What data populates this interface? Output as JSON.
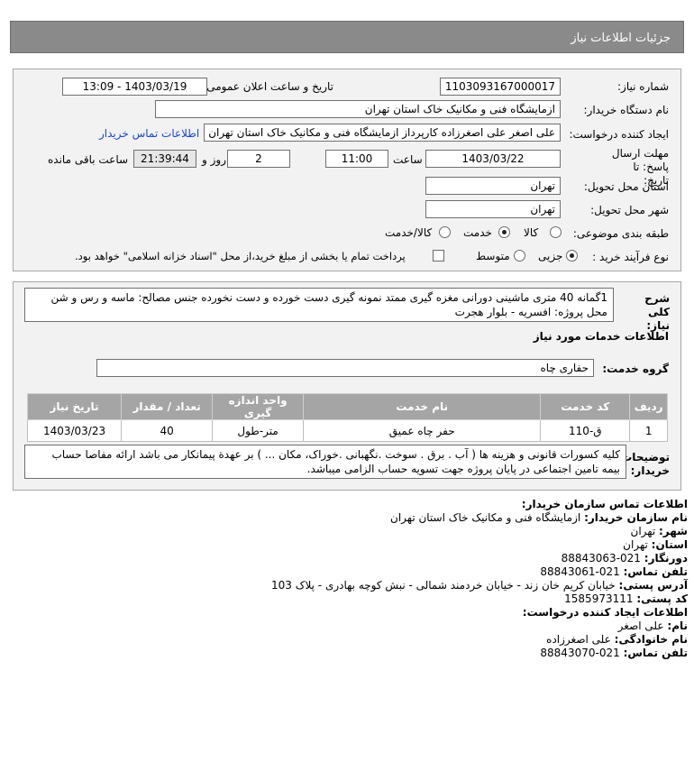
{
  "header": {
    "title": "جزئیات اطلاعات نیاز"
  },
  "need": {
    "number_label": "شماره نیاز:",
    "number": "1103093167000017",
    "announce_label": "تاریخ و ساعت اعلان عمومی:",
    "announce_value": "1403/03/19 - 13:09",
    "buyer_label": "نام دستگاه خریدار:",
    "buyer": "ازمایشگاه فنی و مکانیک خاک استان تهران",
    "creator_label": "ایجاد کننده درخواست:",
    "creator": "علی اصغر علی اصغرزاده کارپرداز ازمایشگاه فنی و مکانیک خاک استان تهران",
    "contact_link": "اطلاعات تماس خریدار",
    "deadline_label": "مهلت ارسال پاسخ: تا تاریخ:",
    "deadline_date": "1403/03/22",
    "time_label": "ساعت",
    "deadline_time": "11:00",
    "days_value": "2",
    "days_label": "روز و",
    "remaining_time": "21:39:44",
    "remaining_label": "ساعت باقی مانده",
    "province_label": "استان محل تحویل:",
    "province": "تهران",
    "city_label": "شهر محل تحویل:",
    "city": "تهران",
    "category_label": "طبقه بندی موضوعی:",
    "category_options": [
      "کالا",
      "خدمت",
      "کالا/خدمت"
    ],
    "category_selected": "خدمت",
    "process_label": "نوع فرآیند خرید :",
    "process_options": [
      "جزیی",
      "متوسط"
    ],
    "process_selected": "جزیی",
    "payment_checkbox_label": "پرداخت تمام یا بخشی از مبلغ خرید،از محل \"اسناد خزانه اسلامی\" خواهد بود."
  },
  "summary": {
    "label": "شرح کلی نیاز:",
    "text_line1": "1گمانه 40 متری ماشینی دورانی مغزه گیری ممتد نمونه گیری دست خورده و دست نخورده جنس مصالح: ماسه و رس و شن",
    "text_line2": "محل پروژه: افسریه - بلوار هجرت"
  },
  "services": {
    "section_title": "اطلاعات خدمات مورد نیاز",
    "group_label": "گروه خدمت:",
    "group_value": "حفاری چاه",
    "columns": [
      "ردیف",
      "کد خدمت",
      "نام خدمت",
      "واحد اندازه گیری",
      "تعداد / مقدار",
      "تاریخ نیاز"
    ],
    "rows": [
      {
        "row": "1",
        "code": "ق-110",
        "name": "حفر چاه عمیق",
        "unit": "متر-طول",
        "qty": "40",
        "date": "1403/03/23"
      }
    ]
  },
  "buyer_notes": {
    "label": "توضیحات خریدار:",
    "line1": "کلیه کسورات قانونی و هزینه ها ( آب . برق . سوخت .نگهبانی .خوراک، مکان ... ) بر عهدة پیمانکار می باشد ارائه مفاصا حساب",
    "line2": "بیمه تامین اجتماعی در پایان پروژه جهت تسویه حساب الزامی میباشد."
  },
  "contact": {
    "title": "اطلاعات تماس سازمان خریدار:",
    "org_label": "نام سازمان خریدار:",
    "org": "ازمایشگاه فنی و مکانیک خاک استان تهران",
    "city_label": "شهر:",
    "city": "تهران",
    "province_label": "استان:",
    "province": "تهران",
    "fax_label": "دورنگار:",
    "fax": "021-88843063",
    "phone_label": "تلفن تماس:",
    "phone": "021-88843061",
    "address_label": "آدرس پستی:",
    "address": "خیابان کریم خان زند - خیابان خردمند شمالی - نبش کوچه بهادری - پلاک 103",
    "postal_label": "کد پستی:",
    "postal": "1585973111",
    "creator_title": "اطلاعات ایجاد کننده درخواست:",
    "first_name_label": "نام:",
    "first_name": "علی اصغر",
    "last_name_label": "نام خانوادگی:",
    "last_name": "علی اصغرزاده",
    "creator_phone_label": "تلفن تماس:",
    "creator_phone": "021-88843070"
  },
  "colors": {
    "header_bg": "#8a8a8a",
    "panel_bg": "#f2f2f2",
    "table_header_bg": "#a5a5a5",
    "link": "#1a47c9"
  }
}
